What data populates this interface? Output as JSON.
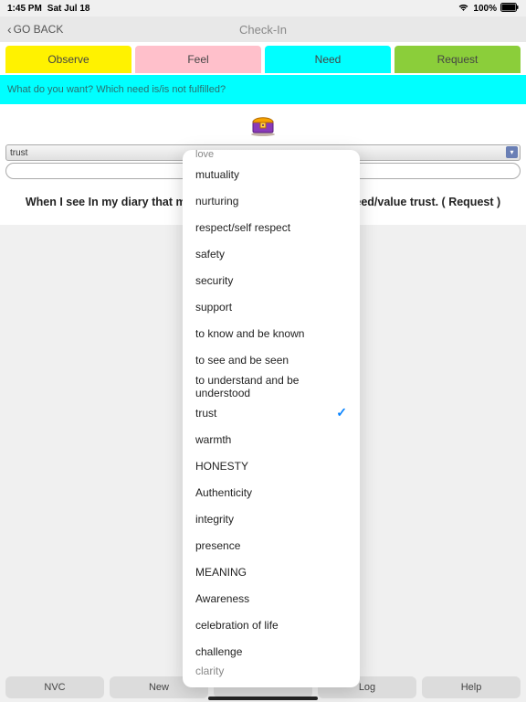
{
  "status": {
    "time": "1:45 PM",
    "date": "Sat Jul 18",
    "battery": "100%"
  },
  "nav": {
    "back": "GO BACK",
    "title": "Check-In"
  },
  "tabs": {
    "observe": "Observe",
    "feel": "Feel",
    "need": "Need",
    "request": "Request"
  },
  "prompt": "What do you want? Which need is/is not fulfilled?",
  "select": {
    "value": "trust"
  },
  "sentence": {
    "pre": "When I see In my diary that my",
    "post": "se I need/value trust. ( Request )"
  },
  "dropdown": {
    "top_cut": "love",
    "items": [
      {
        "label": "mutuality",
        "sel": false
      },
      {
        "label": "nurturing",
        "sel": false
      },
      {
        "label": "respect/self respect",
        "sel": false
      },
      {
        "label": "safety",
        "sel": false
      },
      {
        "label": "security",
        "sel": false
      },
      {
        "label": "support",
        "sel": false
      },
      {
        "label": "to know and be known",
        "sel": false
      },
      {
        "label": "to see and be seen",
        "sel": false
      },
      {
        "label": "to understand and be understood",
        "sel": false
      },
      {
        "label": "trust",
        "sel": true
      },
      {
        "label": "warmth",
        "sel": false
      },
      {
        "label": "HONESTY",
        "sel": false
      },
      {
        "label": "Authenticity",
        "sel": false
      },
      {
        "label": "integrity",
        "sel": false
      },
      {
        "label": "presence",
        "sel": false
      },
      {
        "label": "MEANING",
        "sel": false
      },
      {
        "label": "Awareness",
        "sel": false
      },
      {
        "label": "celebration of life",
        "sel": false
      },
      {
        "label": "challenge",
        "sel": false
      }
    ],
    "bot_cut": "clarity"
  },
  "bottom": {
    "b0": "NVC",
    "b1": "New",
    "b2": "",
    "b3": "Log",
    "b4": "Help"
  },
  "check": "✓"
}
